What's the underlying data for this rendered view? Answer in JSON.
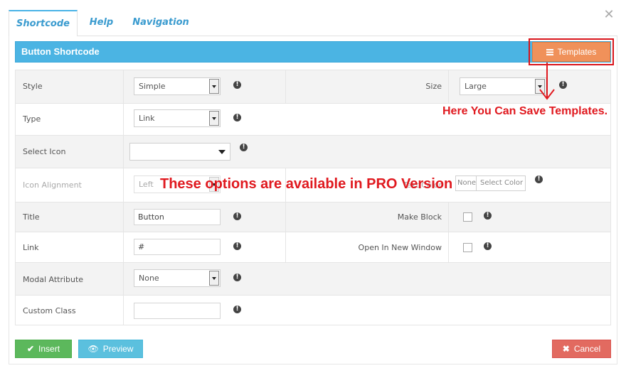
{
  "tabs": [
    "Shortcode",
    "Help",
    "Navigation"
  ],
  "close_glyph": "✕",
  "header": {
    "title": "Button Shortcode",
    "templates_label": "Templates"
  },
  "rows": {
    "style": {
      "label": "Style",
      "value": "Simple"
    },
    "size": {
      "label": "Size",
      "value": "Large"
    },
    "type": {
      "label": "Type",
      "value": "Link"
    },
    "select_icon": {
      "label": "Select Icon",
      "value": ""
    },
    "icon_alignment": {
      "label": "Icon Alignment",
      "value": "Left"
    },
    "color": {
      "label": "Text Color",
      "none_label": "None",
      "select_label": "Select Color"
    },
    "title": {
      "label": "Title",
      "value": "Button"
    },
    "make_block": {
      "label": "Make Block"
    },
    "link": {
      "label": "Link",
      "value": "#"
    },
    "new_window": {
      "label": "Open In New Window"
    },
    "modal": {
      "label": "Modal Attribute",
      "value": "None"
    },
    "custom_class": {
      "label": "Custom Class",
      "value": ""
    }
  },
  "info_glyph": "!",
  "notes": {
    "templates": "Here You Can Save Templates.",
    "pro": "These options are available in PRO Version"
  },
  "buttons": {
    "insert": "Insert",
    "preview": "Preview",
    "cancel": "Cancel"
  },
  "colors": {
    "accent": "#4bb4e3",
    "templates": "#f0915a",
    "insert": "#5cb85c",
    "preview": "#5bc0de",
    "cancel": "#e26a60",
    "annotation": "#e0191f"
  }
}
